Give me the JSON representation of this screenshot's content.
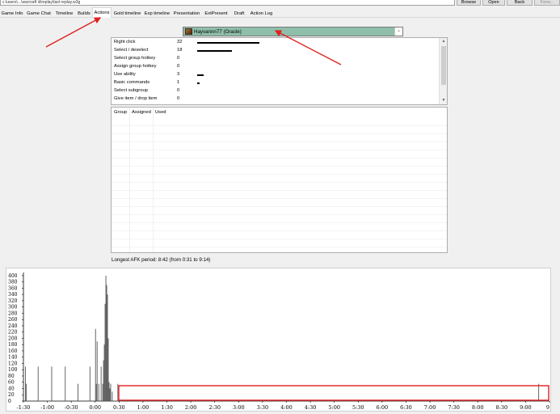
{
  "toolbar": {
    "path_value": "c:\\users\\...\\warcraft iii\\replay\\last replay.w3g",
    "browse_label": "Browse",
    "open_label": "Open",
    "back_label": "Back",
    "forward_label": "Forw..."
  },
  "tabs": [
    {
      "label": "Game Info"
    },
    {
      "label": "Game Chat"
    },
    {
      "label": "Timeline"
    },
    {
      "label": "Builds"
    },
    {
      "label": "Actions",
      "active": true
    },
    {
      "label": "Gold timeline"
    },
    {
      "label": "Exp timeline"
    },
    {
      "label": "Presentation"
    },
    {
      "label": "ExtPresent"
    },
    {
      "label": "Draft"
    },
    {
      "label": "Action Log"
    }
  ],
  "player_select": {
    "value": "Hayvannn77 (Oracle)"
  },
  "actions": [
    {
      "name": "Right click",
      "count": 32
    },
    {
      "name": "Select / deselect",
      "count": 18
    },
    {
      "name": "Select group hotkey",
      "count": 0
    },
    {
      "name": "Assign group hotkey",
      "count": 0
    },
    {
      "name": "Use ability",
      "count": 3
    },
    {
      "name": "Basic commands",
      "count": 1
    },
    {
      "name": "Select subgroup",
      "count": 0
    },
    {
      "name": "Give item / drop item",
      "count": 0
    }
  ],
  "groups_table": {
    "headers": [
      "Group",
      "Assigned",
      "Used"
    ]
  },
  "afk_text": "Longest AFK period: 8:42 (from 0:31 to 9:14)",
  "colors": {
    "player_select_bg": "#8fbfaa",
    "annotation": "#e02020",
    "bars": "#555555"
  },
  "chart_data": {
    "type": "bar",
    "yticks": [
      0,
      20,
      40,
      60,
      80,
      100,
      120,
      140,
      160,
      180,
      200,
      220,
      240,
      260,
      280,
      300,
      320,
      340,
      360,
      380,
      400
    ],
    "ylim": [
      0,
      410
    ],
    "xticks": [
      "-1:30",
      "-1:00",
      "-0:30",
      "0:00",
      "0:30",
      "1:00",
      "1:30",
      "2:00",
      "2:30",
      "3:00",
      "3:30",
      "4:00",
      "4:30",
      "5:00",
      "5:30",
      "6:00",
      "6:30",
      "7:00",
      "7:30",
      "8:00",
      "8:30",
      "9:00",
      "9"
    ],
    "xlim_seconds": [
      -90,
      570
    ],
    "bars": [
      {
        "t": -88,
        "v": 110
      },
      {
        "t": -87,
        "v": 55
      },
      {
        "t": -72,
        "v": 110
      },
      {
        "t": -55,
        "v": 110
      },
      {
        "t": -38,
        "v": 110
      },
      {
        "t": -22,
        "v": 55
      },
      {
        "t": -7,
        "v": 110
      },
      {
        "t": 0,
        "v": 230
      },
      {
        "t": 1,
        "v": 55
      },
      {
        "t": 2,
        "v": 190
      },
      {
        "t": 4,
        "v": 55
      },
      {
        "t": 7,
        "v": 110
      },
      {
        "t": 9,
        "v": 55
      },
      {
        "t": 10,
        "v": 130
      },
      {
        "t": 11,
        "v": 180
      },
      {
        "t": 12,
        "v": 310
      },
      {
        "t": 13,
        "v": 400
      },
      {
        "t": 14,
        "v": 370
      },
      {
        "t": 15,
        "v": 340
      },
      {
        "t": 16,
        "v": 200
      },
      {
        "t": 17,
        "v": 60
      },
      {
        "t": 18,
        "v": 40
      },
      {
        "t": 19,
        "v": 55
      },
      {
        "t": 21,
        "v": 30
      },
      {
        "t": 28,
        "v": 55
      },
      {
        "t": 556,
        "v": 55
      }
    ]
  }
}
